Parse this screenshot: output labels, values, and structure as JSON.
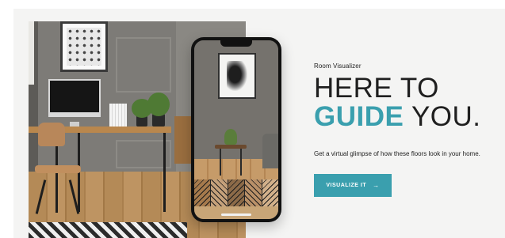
{
  "eyebrow": "Room Visualizer",
  "headline": {
    "line1": "HERE TO",
    "line2_accent": "GUIDE",
    "line2_rest": " YOU."
  },
  "subtext": "Get a virtual glimpse of how these floors look in your home.",
  "cta": {
    "label": "VISUALIZE IT",
    "icon": "arrow-right-icon",
    "arrow_glyph": "→"
  },
  "colors": {
    "accent": "#3a9fae",
    "panel_background": "#f4f4f3",
    "text": "#1f1f1f"
  },
  "phone_swatches": [
    "#a67a4c",
    "#c4a07a",
    "#8c6a48",
    "#b99068",
    "#d2b08a"
  ]
}
